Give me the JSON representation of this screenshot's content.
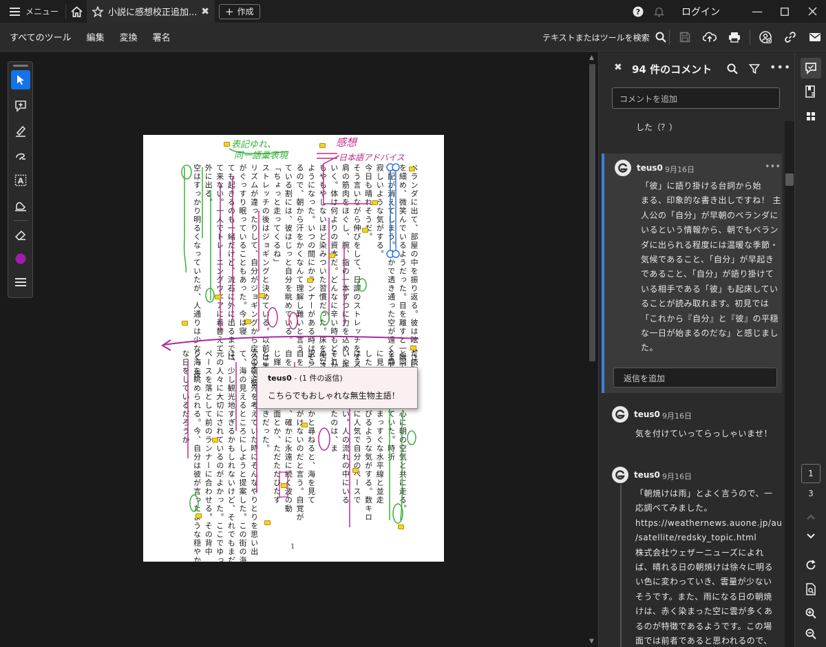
{
  "titlebar": {
    "menu_label": "メニュー",
    "tab_title": "小説に感想校正追加...",
    "new_label": "作成",
    "login_label": "ログイン"
  },
  "toolbar": {
    "menus": [
      "すべてのツール",
      "編集",
      "変換",
      "署名"
    ],
    "search_label": "テキストまたはツールを検索"
  },
  "quick_tools": {
    "icons": [
      "select-arrow-icon",
      "add-comment-icon",
      "highlight-pen-icon",
      "freehand-draw-icon",
      "text-select-icon",
      "stamp-icon",
      "eraser-icon",
      "color-swatch-icon",
      "menu-lines-icon"
    ],
    "active": "select-arrow-icon",
    "swatch_color": "#a21caf"
  },
  "document": {
    "top_columns": [
      "ベランダに出て、部屋の中を振り返る。彼は眩しさに目",
      "を細め、微笑んでいるようだった。目を離すと一瞬で彼の",
      "気配が消えてしまう。静かで透き通った空が遠くまで続",
      "寂しいような気がする。",
      "今日も晴れそうだ。",
      "そう言いながら伸びをして、日課のストレッチをする。",
      "肩の筋肉をほぐし、腕、指の一本ずつに力を込め、抜いて",
      "いく。体は何よりの資本だ。どんなに辛い時もどこかに",
      "もやもやしないほど染みついた習慣だった。床を汚さない",
      "ようになった。いつの間にかランナーがある時はそこで",
      "るので、朝から汗をかくなんて理解し難いと言う",
      "ている割には、彼はじっと自分を眺めている。",
      "「ちょっと走ってくるね」",
      "ストレッチの後はジョギングと決めている。以前は生活",
      "リズムが違ったりして、自分がジョギングから戻るまで彼",
      "がぐっすり眠っていることもあった。今は寝",
      "ても起きるのも一緒だけど、流石に外に出るまでは",
      "て来ない。一人でトレーニングウェアに着替えて",
      "外に出る。",
      "空はすっかり明るくなっていたが、人通りは少なく、夜"
    ],
    "bottom_columns": [
      "だ続く。",
      "と同じように無心に朝の空気と共に走る。",
      "を静けさが漂っていた。時折",
      "に見えてくる。まっすぐな水平線と並走",
      "したい背筋も伸びるような気がする。数キロ",
      "はランナーたちに人気で自分のペースで",
      "いやてはならない。人の流れの中にいる",
      "それはここに来たのは、ま",
      "めなのだから。",
      "訳られた。なぜかと尋ねると、海を見て",
      "自を見ても思いがけないのだと言う。自覚が",
      "自を突かれたが、確かに永遠に続く波の動",
      "じ輝きのない水面とか、ただただひたす",
      "ところとか、好きだった。",
      "次の宿泊先を考えていた時にそんなやりとりを思い出",
      "て、海の見えるところにしようと提案した。この街の海",
      "は、少し観光地すぎるかもしれないけど、それでもまだ地",
      "元の人々に大切にされているのがよかった。ここでゆっく",
      "ペースを落として前のランナーに合わせる。その背中",
      "り海を眺められる。今、自分は彼が言ったような穏やか",
      "な日をしているだろうか"
    ],
    "page_number": "1",
    "annotations": {
      "green_note_1": "表記ゆれ、",
      "green_note_2": "同一語彙表現",
      "pink_note_1": "感想",
      "pink_note_2": "日本語アドバイス"
    },
    "tooltip": {
      "author": "teus0",
      "reply_count": " - (1 件の返信)",
      "text": "こちらでもおしゃれな無生物主語！"
    }
  },
  "comments_panel": {
    "title": "94 件のコメント",
    "add_placeholder": "コメントを追加",
    "prev_tail": "した（？）",
    "comments": [
      {
        "author": "teus0",
        "date": "9月16日",
        "lines": [
          "「彼」に語り掛ける台詞から始",
          "まる、印象的な書き出しですね！ 主",
          "人公の「自分」が早朝のベランダに",
          "いるという情報から、朝でもベラン",
          "ダに出られる程度には温暖な季節・",
          "気候であること、「自分」が早起き",
          "であること、「自分」が語り掛けて",
          "いる相手である「彼」も起床してい",
          "ることが読み取れます。初見では",
          "「これから『自分』と『彼』の平穏",
          "な一日が始まるのだな」と感じまし",
          "た。"
        ],
        "reply_placeholder": "返信を追加"
      },
      {
        "author": "teus0",
        "date": "9月16日",
        "lines": [
          "気を付けていってらっしゃいませ！"
        ]
      },
      {
        "author": "teus0",
        "date": "9月16日",
        "lines": [
          "「朝焼けは雨」とよく言うので、一",
          "応調べてみました。",
          "https://weathernews.auone.jp/au",
          "/satellite/redsky_topic.html",
          "株式会社ウェザーニューズによれ",
          "ば、晴れる日の朝焼けは徐々に明る",
          "い色に変わっていき、雲量が少ない",
          "そうです。また、雨になる日の朝焼",
          "けは、赤く染まった空に雲が多くあ",
          "るのが特徴であるようです。この場",
          "面では前者であると思われるので、"
        ]
      }
    ]
  },
  "rail": {
    "current_page": "1",
    "total_pages": "3"
  }
}
